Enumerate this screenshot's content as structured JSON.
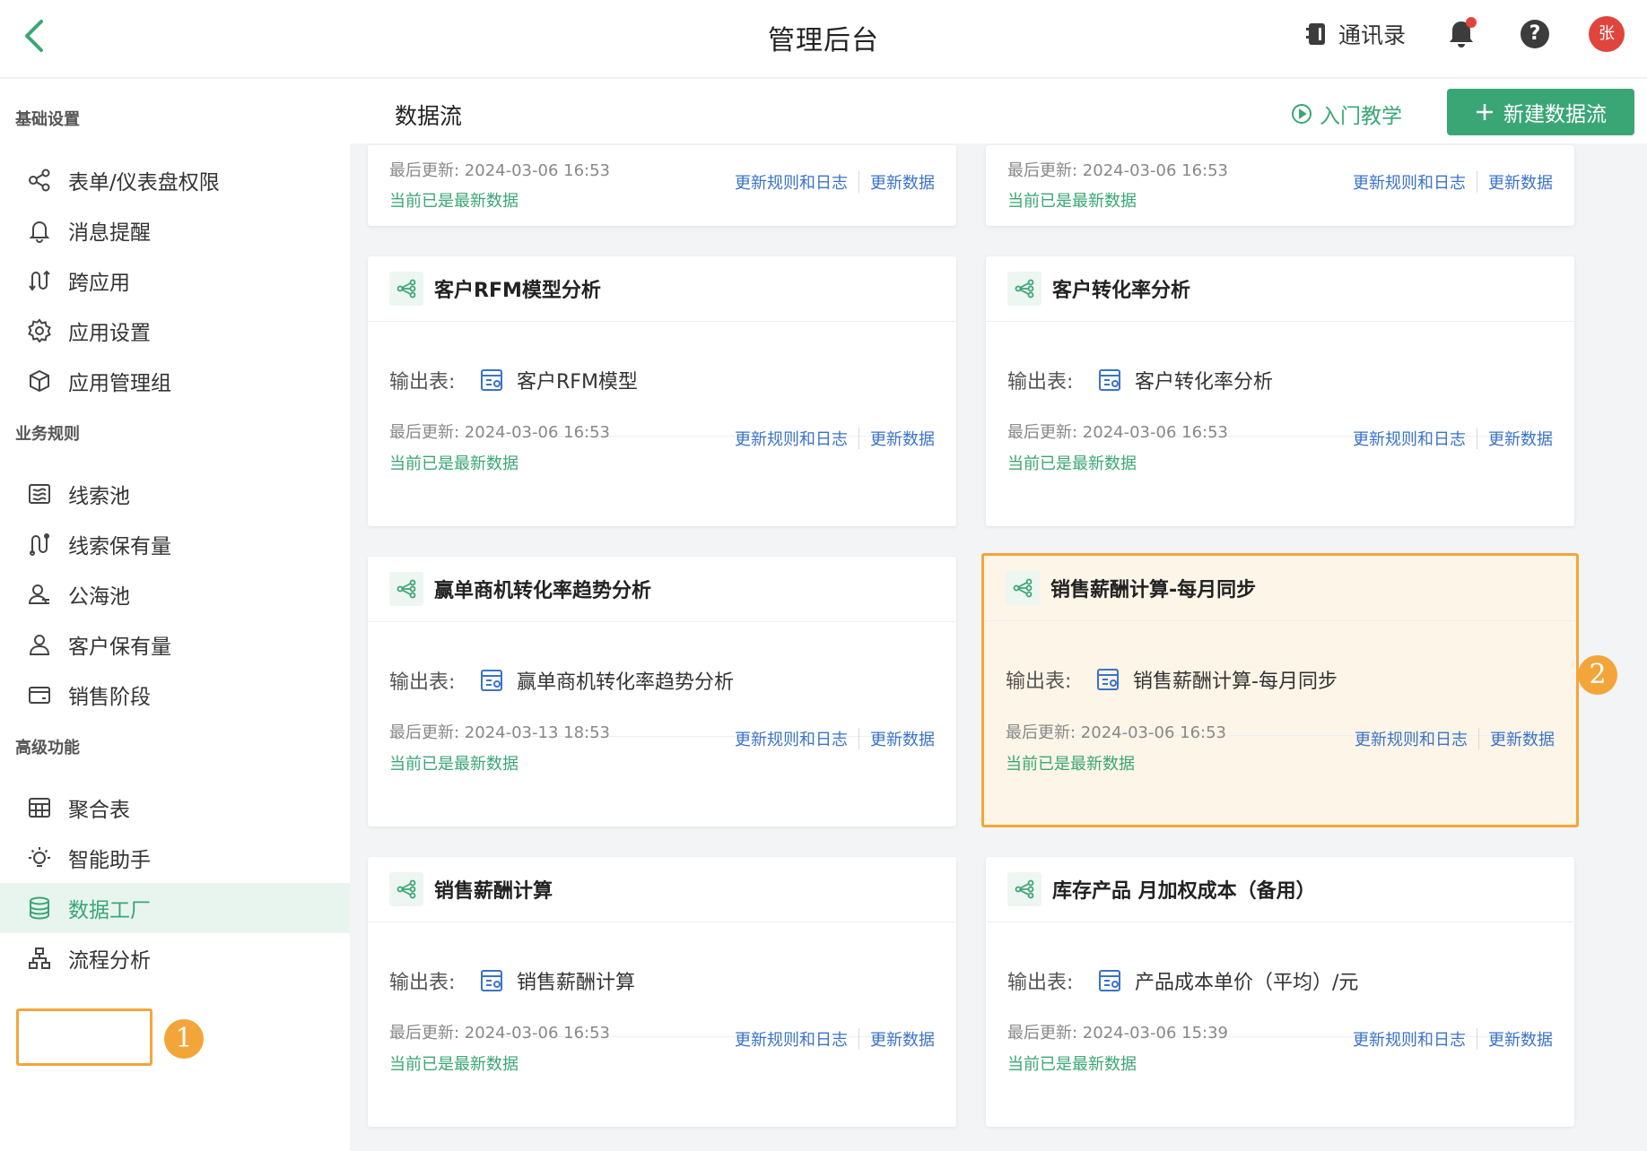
{
  "topbar": {
    "title": "管理后台",
    "contacts_label": "通讯录",
    "help_glyph": "?",
    "avatar_text": "张"
  },
  "sidebar": {
    "groups": [
      {
        "title": "基础设置",
        "items": [
          {
            "label": "表单/仪表盘权限",
            "icon": "share-nodes-icon"
          },
          {
            "label": "消息提醒",
            "icon": "bell-outline-icon"
          },
          {
            "label": "跨应用",
            "icon": "cross-arrows-icon"
          },
          {
            "label": "应用设置",
            "icon": "gear-icon"
          },
          {
            "label": "应用管理组",
            "icon": "cube-icon"
          }
        ]
      },
      {
        "title": "业务规则",
        "items": [
          {
            "label": "线索池",
            "icon": "list-pool-icon"
          },
          {
            "label": "线索保有量",
            "icon": "lead-hold-icon"
          },
          {
            "label": "公海池",
            "icon": "user-group-icon"
          },
          {
            "label": "客户保有量",
            "icon": "user-icon"
          },
          {
            "label": "销售阶段",
            "icon": "card-icon"
          }
        ]
      },
      {
        "title": "高级功能",
        "items": [
          {
            "label": "聚合表",
            "icon": "grid-table-icon"
          },
          {
            "label": "智能助手",
            "icon": "lightbulb-icon"
          },
          {
            "label": "数据工厂",
            "icon": "database-icon",
            "active": true
          },
          {
            "label": "流程分析",
            "icon": "org-chart-icon"
          }
        ]
      }
    ]
  },
  "annotations": {
    "badge1": "1",
    "badge2": "2"
  },
  "main": {
    "page_title": "数据流",
    "tutorial_label": "入门教学",
    "new_button_label": "新建数据流",
    "output_label": "输出表:",
    "update_rules_label": "更新规则和日志",
    "update_data_label": "更新数据",
    "cards": [
      {
        "title": "",
        "output": "",
        "last_update": "最后更新:  2024-03-06 16:53",
        "status": "当前已是最新数据"
      },
      {
        "title": "",
        "output": "",
        "last_update": "最后更新:  2024-03-06 16:53",
        "status": "当前已是最新数据"
      },
      {
        "title": "客户RFM模型分析",
        "output": "客户RFM模型",
        "last_update": "最后更新:  2024-03-06 16:53",
        "status": "当前已是最新数据"
      },
      {
        "title": "客户转化率分析",
        "output": "客户转化率分析",
        "last_update": "最后更新:  2024-03-06 16:53",
        "status": "当前已是最新数据"
      },
      {
        "title": "赢单商机转化率趋势分析",
        "output": "赢单商机转化率趋势分析",
        "last_update": "最后更新:  2024-03-13 18:53",
        "status": "当前已是最新数据"
      },
      {
        "title": "销售薪酬计算-每月同步",
        "output": "销售薪酬计算-每月同步",
        "last_update": "最后更新:  2024-03-06 16:53",
        "status": "当前已是最新数据",
        "highlighted": true
      },
      {
        "title": "销售薪酬计算",
        "output": "销售薪酬计算",
        "last_update": "最后更新:  2024-03-06 16:53",
        "status": "当前已是最新数据"
      },
      {
        "title": "库存产品 月加权成本（备用）",
        "output": "产品成本单价（平均）/元",
        "last_update": "最后更新:  2024-03-06 15:39",
        "status": "当前已是最新数据"
      }
    ]
  },
  "colors": {
    "accent": "#3aa676",
    "link": "#3a73c9",
    "highlight": "#f3a53a",
    "avatar": "#e0453d"
  }
}
